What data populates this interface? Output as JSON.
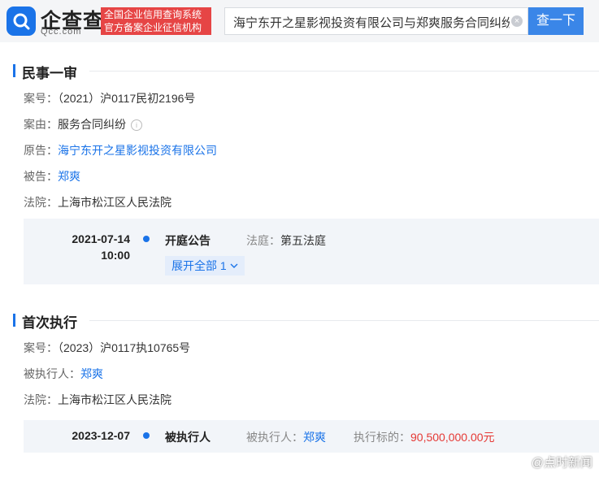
{
  "header": {
    "logo_text": "企查查",
    "logo_sub": "Qcc.com",
    "badge_line1": "全国企业信用查询系统",
    "badge_line2": "官方备案企业征信机构",
    "search_value": "海宁东开之星影视投资有限公司与郑爽服务合同纠纷的案",
    "search_button": "查一下"
  },
  "first_trial": {
    "title": "民事一审",
    "case_no_label": "案号：",
    "case_no": "（2021）沪0117民初2196号",
    "cause_label": "案由：",
    "cause": "服务合同纠纷",
    "plaintiff_label": "原告：",
    "plaintiff": "海宁东开之星影视投资有限公司",
    "defendant_label": "被告：",
    "defendant": "郑爽",
    "court_label": "法院：",
    "court": "上海市松江区人民法院",
    "event": {
      "date": "2021-07-14",
      "time": "10:00",
      "type": "开庭公告",
      "room_label": "法庭：",
      "room": "第五法庭",
      "expand": "展开全部 1"
    }
  },
  "execution": {
    "title": "首次执行",
    "case_no_label": "案号：",
    "case_no": "（2023）沪0117执10765号",
    "executed_label": "被执行人：",
    "executed": "郑爽",
    "court_label": "法院：",
    "court": "上海市松江区人民法院",
    "event": {
      "date": "2023-12-07",
      "type": "被执行人",
      "person_label": "被执行人：",
      "person": "郑爽",
      "amount_label": "执行标的：",
      "amount": "90,500,000.00元"
    }
  },
  "watermark": "@点时新闻",
  "colors": {
    "accent": "#1a73e8",
    "badge": "#e64545",
    "amount": "#e53935"
  }
}
